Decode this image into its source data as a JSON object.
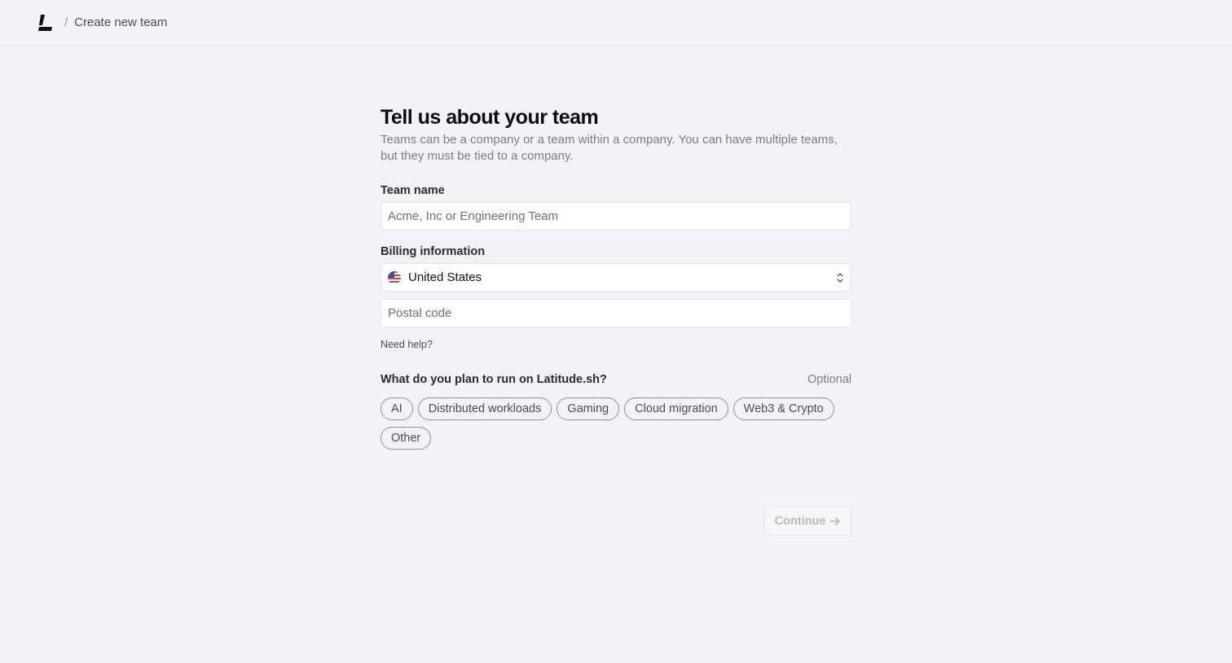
{
  "header": {
    "separator": "/",
    "breadcrumb": "Create new team"
  },
  "form": {
    "title": "Tell us about your team",
    "subtitle": "Teams can be a company or a team within a company. You can have multiple teams, but they must be tied to a company.",
    "team_name": {
      "label": "Team name",
      "value": "",
      "placeholder": "Acme, Inc or Engineering Team"
    },
    "billing": {
      "label": "Billing information",
      "country": "United States",
      "country_flag": "us-flag-icon",
      "postal_placeholder": "Postal code",
      "postal_value": ""
    },
    "help_link": "Need help?",
    "plan": {
      "question": "What do you plan to run on Latitude.sh?",
      "optional": "Optional",
      "options": [
        "AI",
        "Distributed workloads",
        "Gaming",
        "Cloud migration",
        "Web3 & Crypto",
        "Other"
      ]
    },
    "continue_label": "Continue"
  },
  "colors": {
    "background": "#f2f3f6",
    "field_bg": "#ffffff",
    "disabled_text": "#b6b8be"
  }
}
